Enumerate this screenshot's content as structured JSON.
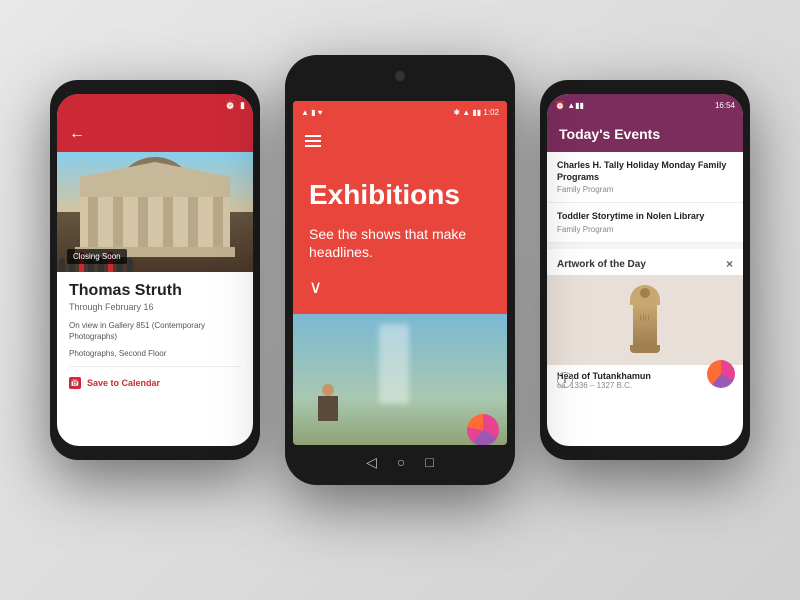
{
  "background": "#d8d8d8",
  "phones": {
    "left": {
      "status_bar": {
        "alarm_icon": "⏰",
        "battery_icon": "▮"
      },
      "header": {
        "back_label": "←"
      },
      "image": {
        "closing_badge": "Closing Soon"
      },
      "content": {
        "title": "Thomas Struth",
        "subtitle": "Through February 16",
        "desc1": "On view in Gallery 851 (Contemporary Photographs)",
        "desc2": "Photographs, Second Floor",
        "action_label": "Save to Calendar"
      }
    },
    "center": {
      "status_bar": {
        "left_icons": "▲ ▮ ♥",
        "right_icons": "✱ ▲ ▮▮ 1:02"
      },
      "header": {
        "menu_icon": "☰"
      },
      "hero": {
        "title": "Exhibitions",
        "tagline": "See the shows that make headlines.",
        "chevron": "∨"
      },
      "image": {
        "alt": "Painting scene with waterfall"
      }
    },
    "right": {
      "status_bar": {
        "alarm_icon": "⏰",
        "signal_icons": "▲▮▮",
        "time": "16:54"
      },
      "header": {
        "title": "Today's Events"
      },
      "events": [
        {
          "title": "Charles H. Tally Holiday Monday Family Programs",
          "type": "Family Program"
        },
        {
          "title": "Toddler Storytime in Nolen Library",
          "type": "Family Program"
        }
      ],
      "artwork_panel": {
        "header": "Artwork of the Day",
        "close_label": "×",
        "artwork_name": "Head of Tutankhamun",
        "artwork_date": "ca. 1336 – 1327 B.C."
      }
    }
  }
}
